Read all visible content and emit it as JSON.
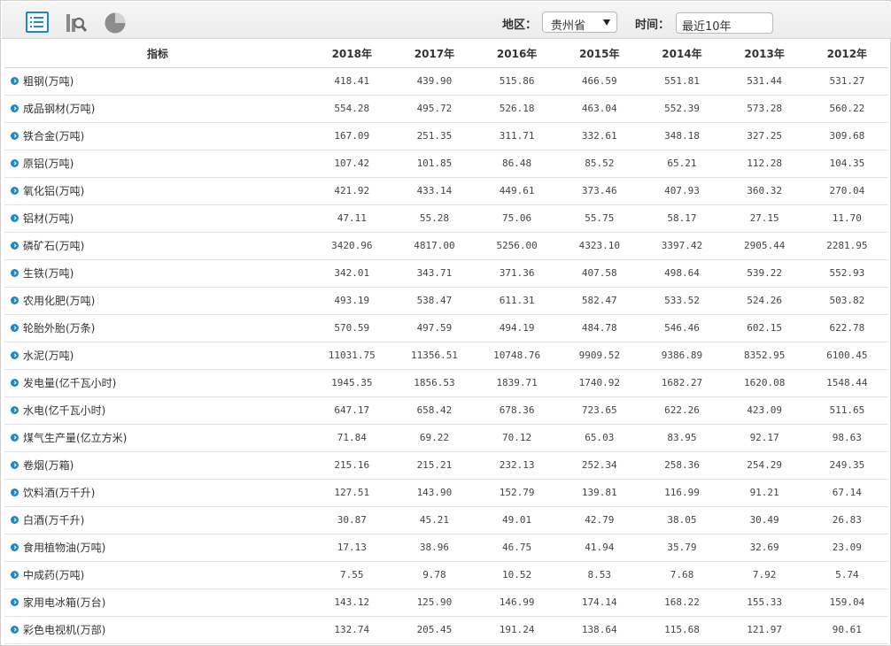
{
  "toolbar": {
    "table_icon": "table-view-icon",
    "bar_icon": "bar-chart-icon",
    "pie_icon": "pie-chart-icon",
    "region_label": "地区：",
    "region_value": "贵州省",
    "time_label": "时间：",
    "time_value": "最近10年"
  },
  "table": {
    "header_indicator": "指标",
    "years": [
      "2018年",
      "2017年",
      "2016年",
      "2015年",
      "2014年",
      "2013年",
      "2012年"
    ],
    "rows": [
      {
        "name": "粗钢(万吨)",
        "values": [
          "418.41",
          "439.90",
          "515.86",
          "466.59",
          "551.81",
          "531.44",
          "531.27"
        ]
      },
      {
        "name": "成品钢材(万吨)",
        "values": [
          "554.28",
          "495.72",
          "526.18",
          "463.04",
          "552.39",
          "573.28",
          "560.22"
        ]
      },
      {
        "name": "铁合金(万吨)",
        "values": [
          "167.09",
          "251.35",
          "311.71",
          "332.61",
          "348.18",
          "327.25",
          "309.68"
        ]
      },
      {
        "name": "原铝(万吨)",
        "values": [
          "107.42",
          "101.85",
          "86.48",
          "85.52",
          "65.21",
          "112.28",
          "104.35"
        ]
      },
      {
        "name": "氧化铝(万吨)",
        "values": [
          "421.92",
          "433.14",
          "449.61",
          "373.46",
          "407.93",
          "360.32",
          "270.04"
        ]
      },
      {
        "name": "铝材(万吨)",
        "values": [
          "47.11",
          "55.28",
          "75.06",
          "55.75",
          "58.17",
          "27.15",
          "11.70"
        ]
      },
      {
        "name": "磷矿石(万吨)",
        "values": [
          "3420.96",
          "4817.00",
          "5256.00",
          "4323.10",
          "3397.42",
          "2905.44",
          "2281.95"
        ]
      },
      {
        "name": "生铁(万吨)",
        "values": [
          "342.01",
          "343.71",
          "371.36",
          "407.58",
          "498.64",
          "539.22",
          "552.93"
        ]
      },
      {
        "name": "农用化肥(万吨)",
        "values": [
          "493.19",
          "538.47",
          "611.31",
          "582.47",
          "533.52",
          "524.26",
          "503.82"
        ]
      },
      {
        "name": "轮胎外胎(万条)",
        "values": [
          "570.59",
          "497.59",
          "494.19",
          "484.78",
          "546.46",
          "602.15",
          "622.78"
        ]
      },
      {
        "name": "水泥(万吨)",
        "values": [
          "11031.75",
          "11356.51",
          "10748.76",
          "9909.52",
          "9386.89",
          "8352.95",
          "6100.45"
        ]
      },
      {
        "name": "发电量(亿千瓦小时)",
        "values": [
          "1945.35",
          "1856.53",
          "1839.71",
          "1740.92",
          "1682.27",
          "1620.08",
          "1548.44"
        ]
      },
      {
        "name": "水电(亿千瓦小时)",
        "values": [
          "647.17",
          "658.42",
          "678.36",
          "723.65",
          "622.26",
          "423.09",
          "511.65"
        ]
      },
      {
        "name": "煤气生产量(亿立方米)",
        "values": [
          "71.84",
          "69.22",
          "70.12",
          "65.03",
          "83.95",
          "92.17",
          "98.63"
        ]
      },
      {
        "name": "卷烟(万箱)",
        "values": [
          "215.16",
          "215.21",
          "232.13",
          "252.34",
          "258.36",
          "254.29",
          "249.35"
        ]
      },
      {
        "name": "饮料酒(万千升)",
        "values": [
          "127.51",
          "143.90",
          "152.79",
          "139.81",
          "116.99",
          "91.21",
          "67.14"
        ]
      },
      {
        "name": "白酒(万千升)",
        "values": [
          "30.87",
          "45.21",
          "49.01",
          "42.79",
          "38.05",
          "30.49",
          "26.83"
        ]
      },
      {
        "name": "食用植物油(万吨)",
        "values": [
          "17.13",
          "38.96",
          "46.75",
          "41.94",
          "35.79",
          "32.69",
          "23.09"
        ]
      },
      {
        "name": "中成药(万吨)",
        "values": [
          "7.55",
          "9.78",
          "10.52",
          "8.53",
          "7.68",
          "7.92",
          "5.74"
        ]
      },
      {
        "name": "家用电冰箱(万台)",
        "values": [
          "143.12",
          "125.90",
          "146.99",
          "174.14",
          "168.22",
          "155.33",
          "159.04"
        ]
      },
      {
        "name": "彩色电视机(万部)",
        "values": [
          "132.74",
          "205.45",
          "191.24",
          "138.64",
          "115.68",
          "121.97",
          "90.61"
        ]
      }
    ]
  }
}
